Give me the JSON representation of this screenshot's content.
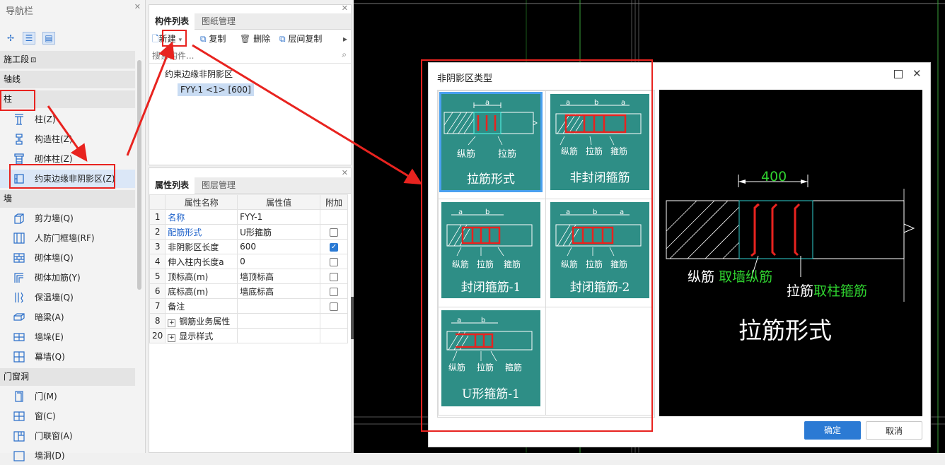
{
  "nav": {
    "title": "导航栏",
    "groups": [
      {
        "label": "施工段",
        "icon": "lock-icon"
      },
      {
        "label": "轴线"
      },
      {
        "label": "柱"
      },
      {
        "label": "墙"
      },
      {
        "label": "门窗洞"
      }
    ],
    "column_items": [
      "柱(Z)",
      "构造柱(Z)",
      "砌体柱(Z)",
      "约束边缘非阴影区(Z)"
    ],
    "wall_items": [
      "剪力墙(Q)",
      "人防门框墙(RF)",
      "砌体墙(Q)",
      "砌体加筋(Y)",
      "保温墙(Q)",
      "暗梁(A)",
      "墙垛(E)",
      "幕墙(Q)"
    ],
    "door_items": [
      "门(M)",
      "窗(C)",
      "门联窗(A)",
      "墙洞(D)"
    ]
  },
  "component_panel": {
    "tabs": [
      "构件列表",
      "图纸管理"
    ],
    "toolbar": {
      "new": "新建",
      "copy": "复制",
      "delete": "删除",
      "floor_copy": "层间复制"
    },
    "search_placeholder": "搜索构件...",
    "tree_parent": "约束边缘非阴影区",
    "tree_child": "FYY-1 <1> [600]"
  },
  "property_panel": {
    "tabs": [
      "属性列表",
      "图层管理"
    ],
    "headers": [
      "属性名称",
      "属性值",
      "附加"
    ],
    "rows": [
      {
        "no": "1",
        "name": "名称",
        "value": "FYY-1",
        "checkbox": "none"
      },
      {
        "no": "2",
        "name": "配筋形式",
        "value": "U形箍筋",
        "checkbox": "off"
      },
      {
        "no": "3",
        "name": "非阴影区长度",
        "value": "600",
        "checkbox": "on"
      },
      {
        "no": "4",
        "name": "伸入柱内长度a",
        "value": "0",
        "checkbox": "off"
      },
      {
        "no": "5",
        "name": "顶标高(m)",
        "value": "墙顶标高",
        "checkbox": "off"
      },
      {
        "no": "6",
        "name": "底标高(m)",
        "value": "墙底标高",
        "checkbox": "off"
      },
      {
        "no": "7",
        "name": "备注",
        "value": "",
        "checkbox": "off"
      },
      {
        "no": "8",
        "name": "钢筋业务属性",
        "value": "",
        "checkbox": "none"
      },
      {
        "no": "20",
        "name": "显示样式",
        "value": "",
        "checkbox": "none"
      }
    ]
  },
  "dialog": {
    "title": "非阴影区类型",
    "cards": [
      {
        "name": "拉筋形式",
        "labels": [
          "纵筋",
          "拉筋"
        ],
        "dims": [
          "a"
        ]
      },
      {
        "name": "非封闭箍筋",
        "labels": [
          "纵筋",
          "拉筋",
          "箍筋"
        ],
        "dims": [
          "a",
          "b",
          "a"
        ]
      },
      {
        "name": "封闭箍筋-1",
        "labels": [
          "纵筋",
          "拉筋",
          "箍筋"
        ],
        "dims": [
          "a",
          "b"
        ]
      },
      {
        "name": "封闭箍筋-2",
        "labels": [
          "纵筋",
          "拉筋",
          "箍筋"
        ],
        "dims": [
          "a",
          "b",
          "a"
        ]
      },
      {
        "name": "U形箍筋-1",
        "labels": [
          "纵筋",
          "拉筋",
          "箍筋"
        ],
        "dims": [
          "a",
          "b"
        ]
      }
    ],
    "preview": {
      "dimension": "400",
      "label1": "纵筋",
      "label1_green": "取墙纵筋",
      "label2": "拉筋",
      "label2_green": "取柱箍筋",
      "title": "拉筋形式"
    },
    "ok": "确定",
    "cancel": "取消"
  },
  "colors": {
    "accent": "#2b7ad4",
    "card": "#2e8e86",
    "annotation": "#e8231f",
    "preview_green": "#2fd12f"
  }
}
